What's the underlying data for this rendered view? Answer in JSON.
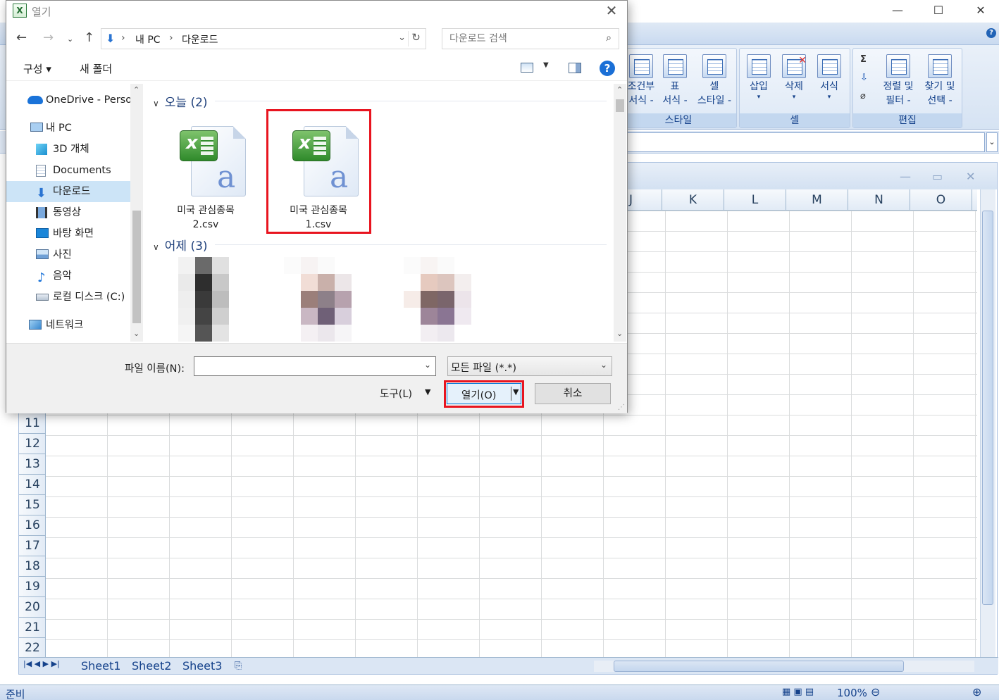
{
  "excel": {
    "ribbon": {
      "groups": [
        {
          "label": "스타일",
          "buttons": [
            "조건부\n서식 -",
            "표\n서식 -",
            "셀\n스타일 -"
          ]
        },
        {
          "label": "셀",
          "buttons": [
            "삽입",
            "삭제",
            "서식"
          ]
        },
        {
          "label": "편집",
          "buttons": [
            "정렬 및\n필터 -",
            "찾기 및\n선택 -"
          ]
        }
      ],
      "small_icons": [
        "Σ",
        "⇩",
        "⌀"
      ]
    },
    "columns": [
      "J",
      "K",
      "L",
      "M",
      "N",
      "O"
    ],
    "rows": [
      "11",
      "12",
      "13",
      "14",
      "15",
      "16",
      "17",
      "18",
      "19",
      "20",
      "21",
      "22"
    ],
    "sheets": [
      "Sheet1",
      "Sheet2",
      "Sheet3"
    ],
    "status": {
      "ready": "준비",
      "zoom": "100%"
    }
  },
  "dialog": {
    "title": "열기",
    "breadcrumb": [
      "내 PC",
      "다운로드"
    ],
    "search_placeholder": "다운로드 검색",
    "toolbar": {
      "organize": "구성 ▾",
      "new_folder": "새 폴더"
    },
    "nav_items": [
      {
        "label": "OneDrive - Personal",
        "icon": "onedrive-icon",
        "selected": false
      },
      {
        "label": "내 PC",
        "icon": "pc-icon",
        "selected": false
      },
      {
        "label": "3D 개체",
        "icon": "3d-objects-icon",
        "selected": false
      },
      {
        "label": "Documents",
        "icon": "documents-icon",
        "selected": false
      },
      {
        "label": "다운로드",
        "icon": "downloads-icon",
        "selected": true
      },
      {
        "label": "동영상",
        "icon": "videos-icon",
        "selected": false
      },
      {
        "label": "바탕 화면",
        "icon": "desktop-icon",
        "selected": false
      },
      {
        "label": "사진",
        "icon": "pictures-icon",
        "selected": false
      },
      {
        "label": "음악",
        "icon": "music-icon",
        "selected": false
      },
      {
        "label": "로컬 디스크 (C:)",
        "icon": "local-disk-icon",
        "selected": false
      },
      {
        "label": "네트워크",
        "icon": "network-icon",
        "selected": false
      }
    ],
    "groups": [
      {
        "header": "오늘 (2)",
        "files": [
          {
            "name_line1": "미국 관심종목",
            "name_line2": "2.csv",
            "highlighted": false
          },
          {
            "name_line1": "미국 관심종목",
            "name_line2": "1.csv",
            "highlighted": true
          }
        ]
      },
      {
        "header": "어제 (3)",
        "files": []
      }
    ],
    "filename_label": "파일 이름(N):",
    "filename_value": "",
    "filetype": "모든 파일 (*.*)",
    "tools_label": "도구(L)",
    "open_label": "열기(O)",
    "cancel_label": "취소"
  }
}
